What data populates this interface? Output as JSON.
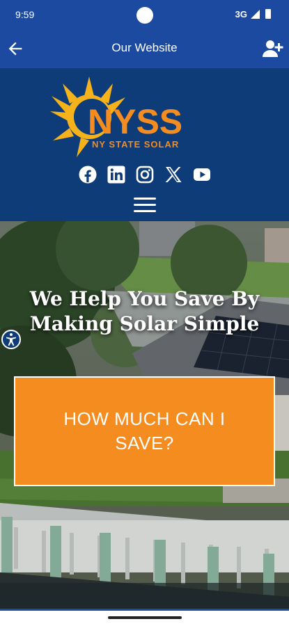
{
  "status_bar": {
    "time": "9:59",
    "network": "3G"
  },
  "app_bar": {
    "title": "Our Website"
  },
  "logo": {
    "brand": "NYSS",
    "tagline": "NY STATE SOLAR"
  },
  "social": [
    "facebook-icon",
    "linkedin-icon",
    "instagram-icon",
    "x-icon",
    "youtube-icon"
  ],
  "hero": {
    "heading": "We Help You Save By Making Solar Simple",
    "cta_label": "HOW MUCH CAN I SAVE?"
  },
  "colors": {
    "app_bar": "#1b4aa0",
    "header": "#0d3c78",
    "accent": "#f58c1f"
  }
}
